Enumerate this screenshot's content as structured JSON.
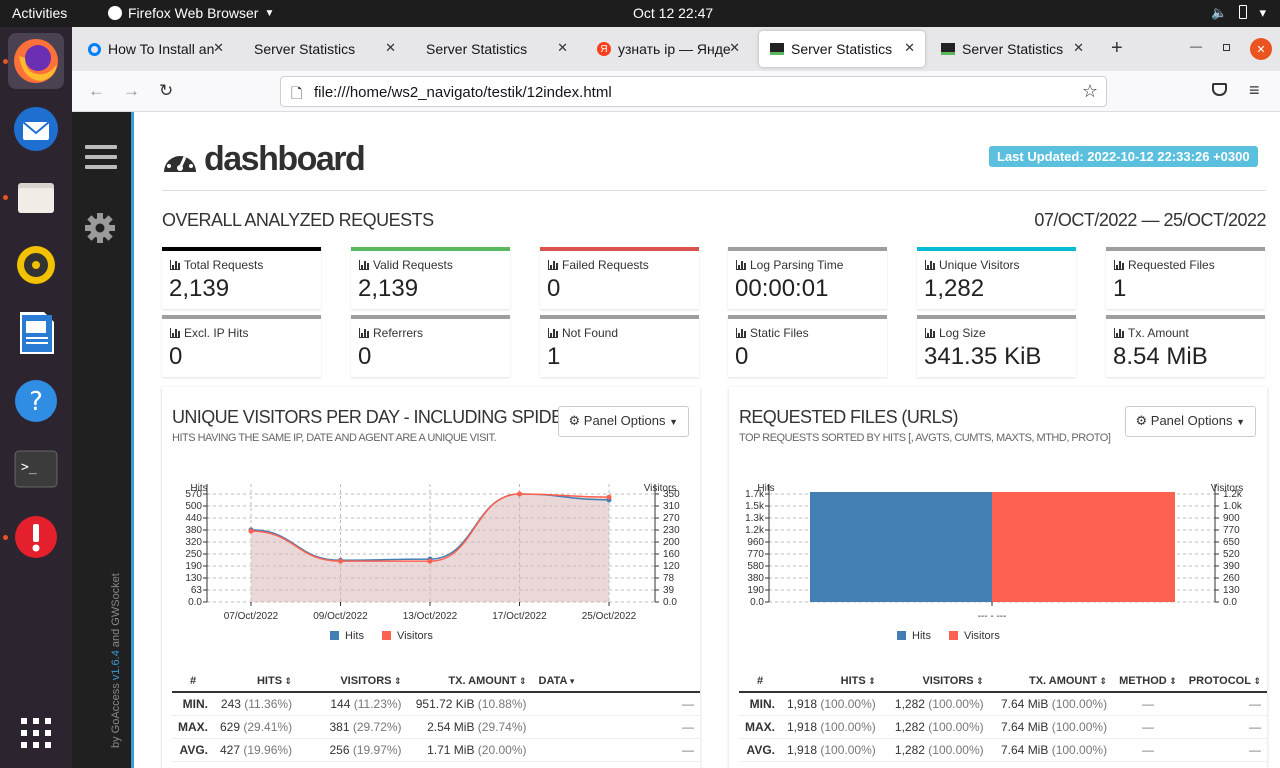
{
  "topbar": {
    "activities": "Activities",
    "app_name": "Firefox Web Browser",
    "clock": "Oct 12  22:47"
  },
  "dock": {
    "items": [
      "Firefox",
      "Thunderbird",
      "Files",
      "Rhythmbox",
      "LibreOffice Writer",
      "Help",
      "Terminal",
      "Software Updater",
      "Show Applications"
    ]
  },
  "browser": {
    "tabs": [
      {
        "title": "How To Install an",
        "favicon": "digitalocean-icon"
      },
      {
        "title": "Server Statistics",
        "favicon": ""
      },
      {
        "title": "Server Statistics",
        "favicon": ""
      },
      {
        "title": "узнать ip — Янде",
        "favicon": "yandex-icon"
      },
      {
        "title": "Server Statistics",
        "favicon": "goaccess-icon"
      },
      {
        "title": "Server Statistics",
        "favicon": "goaccess-icon"
      }
    ],
    "url": "file:///home/ws2_navigato/testik/12index.html"
  },
  "sidebar": {
    "credit_prefix": "by GoAccess ",
    "version": "v1.6.4",
    "credit_suffix": " and GWSocket"
  },
  "dashboard": {
    "title": "dashboard",
    "last_updated": "Last Updated: 2022-10-12 22:33:26 +0300",
    "overall_title": "OVERALL ANALYZED REQUESTS",
    "date_range": "07/OCT/2022 — 25/OCT/2022",
    "cards": [
      {
        "label": "Total Requests",
        "value": "2,139",
        "color": "#000000"
      },
      {
        "label": "Valid Requests",
        "value": "2,139",
        "color": "#5cb85c"
      },
      {
        "label": "Failed Requests",
        "value": "0",
        "color": "#d9534f"
      },
      {
        "label": "Log Parsing Time",
        "value": "00:00:01",
        "color": "#9e9e9e"
      },
      {
        "label": "Unique Visitors",
        "value": "1,282",
        "color": "#00bcd4"
      },
      {
        "label": "Requested Files",
        "value": "1",
        "color": "#9e9e9e"
      },
      {
        "label": "Excl. IP Hits",
        "value": "0",
        "color": "#9e9e9e"
      },
      {
        "label": "Referrers",
        "value": "0",
        "color": "#9e9e9e"
      },
      {
        "label": "Not Found",
        "value": "1",
        "color": "#9e9e9e"
      },
      {
        "label": "Static Files",
        "value": "0",
        "color": "#9e9e9e"
      },
      {
        "label": "Log Size",
        "value": "341.35 KiB",
        "color": "#9e9e9e"
      },
      {
        "label": "Tx. Amount",
        "value": "8.54 MiB",
        "color": "#9e9e9e"
      }
    ]
  },
  "visitors_panel": {
    "title": "UNIQUE VISITORS PER DAY - INCLUDING SPIDERS",
    "subtitle": "HITS HAVING THE SAME IP, DATE AND AGENT ARE A UNIQUE VISIT.",
    "options": "Panel Options",
    "table": {
      "headers": [
        "#",
        "HITS",
        "VISITORS",
        "TX. AMOUNT",
        "DATA"
      ],
      "rows": [
        {
          "k": "MIN.",
          "hits": "243",
          "hits_pct": "(11.36%)",
          "vis": "144",
          "vis_pct": "(11.23%)",
          "tx": "951.72 KiB",
          "tx_pct": "(10.88%)",
          "data": "—"
        },
        {
          "k": "MAX.",
          "hits": "629",
          "hits_pct": "(29.41%)",
          "vis": "381",
          "vis_pct": "(29.72%)",
          "tx": "2.54 MiB",
          "tx_pct": "(29.74%)",
          "data": "—"
        },
        {
          "k": "AVG.",
          "hits": "427",
          "hits_pct": "(19.96%)",
          "vis": "256",
          "vis_pct": "(19.97%)",
          "tx": "1.71 MiB",
          "tx_pct": "(20.00%)",
          "data": "—"
        }
      ]
    }
  },
  "files_panel": {
    "title": "REQUESTED FILES (URLS)",
    "subtitle": "TOP REQUESTS SORTED BY HITS [, AVGTS, CUMTS, MAXTS, MTHD, PROTO]",
    "options": "Panel Options",
    "table": {
      "headers": [
        "#",
        "HITS",
        "VISITORS",
        "TX. AMOUNT",
        "METHOD",
        "PROTOCOL"
      ],
      "rows": [
        {
          "k": "MIN.",
          "hits": "1,918",
          "hits_pct": "(100.00%)",
          "vis": "1,282",
          "vis_pct": "(100.00%)",
          "tx": "7.64 MiB",
          "tx_pct": "(100.00%)",
          "method": "—",
          "proto": "—"
        },
        {
          "k": "MAX.",
          "hits": "1,918",
          "hits_pct": "(100.00%)",
          "vis": "1,282",
          "vis_pct": "(100.00%)",
          "tx": "7.64 MiB",
          "tx_pct": "(100.00%)",
          "method": "—",
          "proto": "—"
        },
        {
          "k": "AVG.",
          "hits": "1,918",
          "hits_pct": "(100.00%)",
          "vis": "1,282",
          "vis_pct": "(100.00%)",
          "tx": "7.64 MiB",
          "tx_pct": "(100.00%)",
          "method": "—",
          "proto": "—"
        }
      ]
    }
  },
  "chart_data": [
    {
      "type": "area",
      "ylabel": "Hits",
      "y2label": "Visitors",
      "categories": [
        "07/Oct/2022",
        "09/Oct/2022",
        "13/Oct/2022",
        "17/Oct/2022",
        "25/Oct/2022"
      ],
      "series": [
        {
          "name": "Hits",
          "values": [
            420,
            243,
            250,
            629,
            595
          ],
          "color": "#447fb3"
        },
        {
          "name": "Visitors",
          "values": [
            250,
            144,
            144,
            381,
            370
          ],
          "color": "#ff6150"
        }
      ],
      "yticks": [
        "0.0",
        "63",
        "130",
        "190",
        "250",
        "320",
        "380",
        "440",
        "500",
        "570"
      ],
      "y2ticks": [
        "0.0",
        "39",
        "78",
        "120",
        "160",
        "200",
        "230",
        "270",
        "310",
        "350"
      ],
      "ylim": [
        0,
        629
      ],
      "y2lim": [
        0,
        381
      ],
      "grid": true
    },
    {
      "type": "bar",
      "ylabel": "Hits",
      "y2label": "Visitors",
      "categories": [
        "--- - ---"
      ],
      "series": [
        {
          "name": "Hits",
          "values": [
            1918
          ],
          "color": "#447fb3"
        },
        {
          "name": "Visitors",
          "values": [
            1282
          ],
          "color": "#ff6150"
        }
      ],
      "yticks": [
        "0.0",
        "190",
        "380",
        "580",
        "770",
        "960",
        "1.2k",
        "1.3k",
        "1.5k",
        "1.7k"
      ],
      "y2ticks": [
        "0.0",
        "130",
        "260",
        "390",
        "520",
        "650",
        "770",
        "900",
        "1.0k",
        "1.2k"
      ],
      "ylim": [
        0,
        1918
      ],
      "y2lim": [
        0,
        1282
      ],
      "grid": true
    }
  ]
}
